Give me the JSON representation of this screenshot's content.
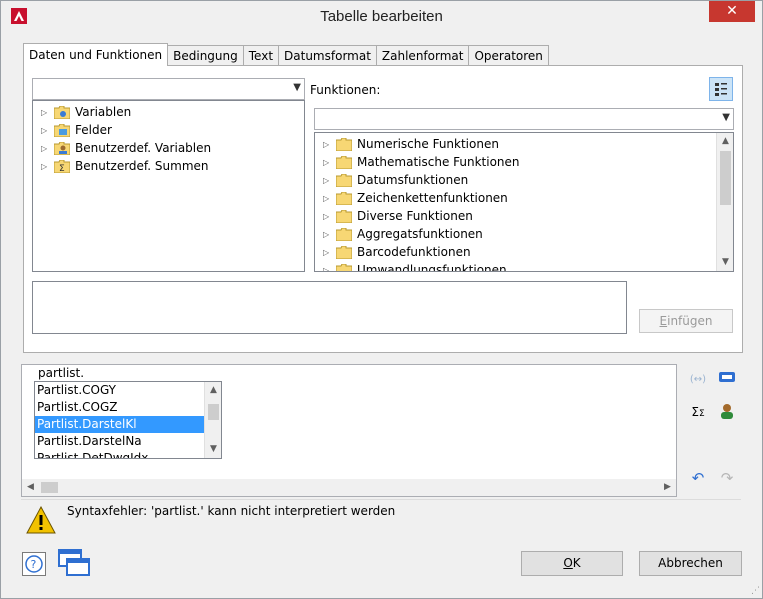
{
  "window": {
    "title": "Tabelle bearbeiten",
    "close_glyph": "✕"
  },
  "tabs": [
    {
      "label": "Daten und Funktionen",
      "active": true
    },
    {
      "label": "Bedingung",
      "active": false
    },
    {
      "label": "Text",
      "active": false
    },
    {
      "label": "Datumsformat",
      "active": false
    },
    {
      "label": "Zahlenformat",
      "active": false
    },
    {
      "label": "Operatoren",
      "active": false
    }
  ],
  "data_panel": {
    "combo_value": "",
    "items": [
      {
        "label": "Variablen",
        "icon": "variable-icon"
      },
      {
        "label": "Felder",
        "icon": "fields-icon"
      },
      {
        "label": "Benutzerdef. Variablen",
        "icon": "user-variable-icon"
      },
      {
        "label": "Benutzerdef. Summen",
        "icon": "user-sum-icon"
      }
    ]
  },
  "functions_panel": {
    "label": "Funktionen:",
    "combo_value": "",
    "items": [
      {
        "label": "Numerische Funktionen"
      },
      {
        "label": "Mathematische Funktionen"
      },
      {
        "label": "Datumsfunktionen"
      },
      {
        "label": "Zeichenkettenfunktionen"
      },
      {
        "label": "Diverse Funktionen"
      },
      {
        "label": "Aggregatsfunktionen"
      },
      {
        "label": "Barcodefunktionen"
      },
      {
        "label": "Umwandlungsfunktionen"
      }
    ]
  },
  "insert_button": {
    "mnemonic": "E",
    "rest": "infügen"
  },
  "editor": {
    "text": "partlist.",
    "autocomplete": [
      {
        "label": "Partlist.COGY",
        "selected": false
      },
      {
        "label": "Partlist.COGZ",
        "selected": false
      },
      {
        "label": "Partlist.DarstelKl",
        "selected": true
      },
      {
        "label": "Partlist.DarstelNa",
        "selected": false
      },
      {
        "label": "Partlist.DetDwgIdx",
        "selected": false
      }
    ]
  },
  "status": {
    "message": "Syntaxfehler: 'partlist.' kann nicht interpretiert werden"
  },
  "buttons": {
    "ok_mnemonic": "O",
    "ok_rest": "K",
    "cancel_label": "Abbrechen"
  },
  "colors": {
    "accent": "#3399ff",
    "close": "#c7372f",
    "folder": "#f7d774",
    "warning": "#f2c200"
  }
}
